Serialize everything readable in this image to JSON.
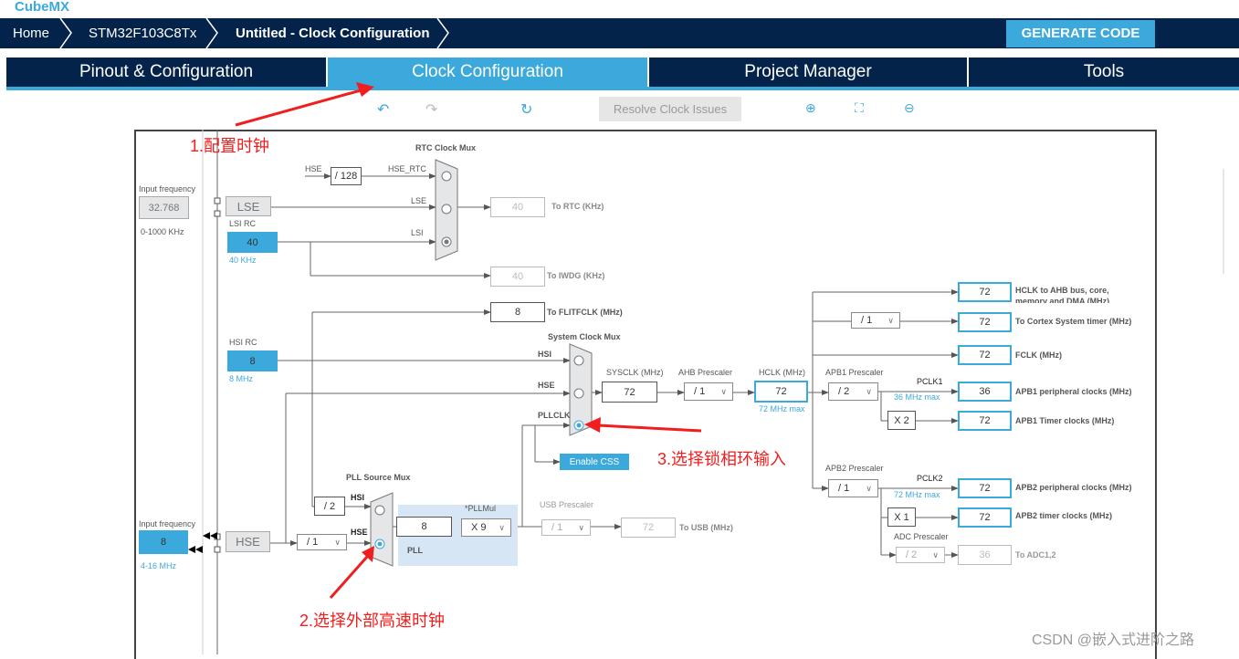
{
  "header": {
    "logo": "CubeMX",
    "breadcrumbs": [
      "Home",
      "STM32F103C8Tx",
      "Untitled - Clock Configuration"
    ],
    "generate_code": "GENERATE CODE"
  },
  "tabs": [
    {
      "label": "Pinout & Configuration",
      "active": false
    },
    {
      "label": "Clock Configuration",
      "active": true
    },
    {
      "label": "Project Manager",
      "active": false
    },
    {
      "label": "Tools",
      "active": false
    }
  ],
  "toolbar": {
    "resolve": "Resolve Clock Issues",
    "icons": [
      "undo-icon",
      "redo-icon",
      "reset-icon",
      "zoom-in-icon",
      "fit-icon",
      "zoom-out-icon"
    ]
  },
  "diagram": {
    "lse_input": {
      "label": "Input frequency",
      "value": "32.768",
      "range": "0-1000 KHz"
    },
    "lse": "LSE",
    "lsi": {
      "label": "LSI RC",
      "value": "40",
      "unit": "40 KHz"
    },
    "rtc_mux": {
      "title": "RTC Clock Mux",
      "hse": "HSE",
      "div": "/ 128",
      "hse_rtc": "HSE_RTC",
      "lse": "LSE",
      "lsi": "LSI"
    },
    "rtc_out": {
      "value": "40",
      "label": "To RTC (KHz)"
    },
    "iwdg_out": {
      "value": "40",
      "label": "To IWDG (KHz)"
    },
    "flit_out": {
      "value": "8",
      "label": "To FLITFCLK (MHz)"
    },
    "hsi": {
      "label": "HSI RC",
      "value": "8",
      "unit": "8 MHz"
    },
    "sys_mux": {
      "title": "System Clock Mux",
      "hsi": "HSI",
      "hse": "HSE",
      "pllclk": "PLLCLK"
    },
    "sysclk": {
      "label": "SYSCLK (MHz)",
      "value": "72"
    },
    "ahb": {
      "label": "AHB Prescaler",
      "value": "/ 1"
    },
    "hclk": {
      "label": "HCLK (MHz)",
      "value": "72",
      "max": "72 MHz max"
    },
    "apb1": {
      "label": "APB1 Prescaler",
      "value": "/ 2",
      "pclk": "PCLK1",
      "max": "36 MHz max",
      "mul": "X 2"
    },
    "apb2": {
      "label": "APB2 Prescaler",
      "value": "/ 1",
      "pclk": "PCLK2",
      "max": "72 MHz max",
      "mul": "X 1"
    },
    "adc": {
      "label": "ADC Prescaler",
      "value": "/ 2"
    },
    "cortex_div": "/ 1",
    "outputs": [
      {
        "value": "72",
        "label": "HCLK to AHB bus, core, memory and DMA (MHz)"
      },
      {
        "value": "72",
        "label": "To Cortex System timer (MHz)"
      },
      {
        "value": "72",
        "label": "FCLK (MHz)"
      },
      {
        "value": "36",
        "label": "APB1 peripheral clocks (MHz)"
      },
      {
        "value": "72",
        "label": "APB1 Timer clocks (MHz)"
      },
      {
        "value": "72",
        "label": "APB2 peripheral clocks (MHz)"
      },
      {
        "value": "72",
        "label": "APB2 timer clocks (MHz)"
      },
      {
        "value": "36",
        "label": "To ADC1,2"
      }
    ],
    "enable_css": "Enable CSS",
    "pll_mux": {
      "title": "PLL Source Mux",
      "hsi": "HSI",
      "hse": "HSE",
      "div2": "/ 2"
    },
    "pll": {
      "label": "PLL",
      "value": "8",
      "mul_label": "*PLLMul",
      "mul": "X 9"
    },
    "usb": {
      "label": "USB Prescaler",
      "div": "/ 1",
      "value": "72",
      "out": "To USB (MHz)"
    },
    "hse": "HSE",
    "hse_input": {
      "label": "Input frequency",
      "value": "8",
      "range": "4-16 MHz"
    },
    "hse_div": "/ 1"
  },
  "annotations": [
    "1.配置时钟",
    "2.选择外部高速时钟",
    "3.选择锁相环输入"
  ],
  "watermark": "CSDN @嵌入式进阶之路",
  "colors": {
    "nav": "#03234b",
    "accent": "#3ca9dc",
    "annotation": "#f01e1e"
  }
}
